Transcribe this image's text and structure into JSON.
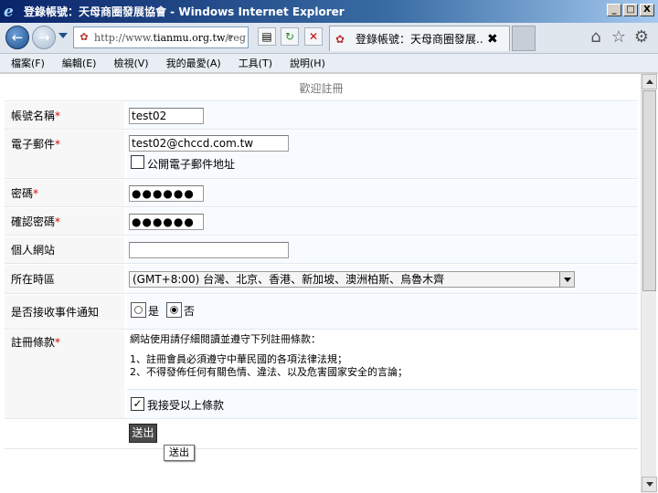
{
  "window": {
    "title": "登錄帳號：天母商圈發展協會 - Windows Internet Explorer",
    "minimize": "_",
    "maximize": "□",
    "close": "X"
  },
  "address": {
    "url_prefix": "http://www.",
    "url_domain": "tianmu.org.tw",
    "url_rest": "/reg"
  },
  "tab": {
    "title": "登錄帳號：天母商圈發展...",
    "close": "✖"
  },
  "menu": [
    "檔案(F)",
    "編輯(E)",
    "檢視(V)",
    "我的最愛(A)",
    "工具(T)",
    "說明(H)"
  ],
  "form": {
    "header": "歡迎註冊",
    "required_mark": "*",
    "username": {
      "label": "帳號名稱",
      "value": "test02"
    },
    "email": {
      "label": "電子郵件",
      "value": "test02@chccd.com.tw",
      "public_label": "公開電子郵件地址"
    },
    "password": {
      "label": "密碼",
      "value": "●●●●●●"
    },
    "confirm_password": {
      "label": "確認密碼",
      "value": "●●●●●●"
    },
    "website": {
      "label": "個人網站",
      "value": ""
    },
    "timezone": {
      "label": "所在時區",
      "value": "(GMT+8:00) 台灣、北京、香港、新加坡、澳洲柏斯、烏魯木齊"
    },
    "notify": {
      "label": "是否接收事件通知",
      "yes": "是",
      "no": "否"
    },
    "terms": {
      "label": "註冊條款",
      "line1": "網站使用請仔細閱讀並遵守下列註冊條款：",
      "line2": "1、註冊會員必須遵守中華民國的各項法律法規；",
      "line3": "2、不得發佈任何有關色情、違法、以及危害國家安全的言論；",
      "accept": "我接受以上條款",
      "accept_check": "✓"
    },
    "submit": "送出",
    "tooltip": "送出"
  }
}
